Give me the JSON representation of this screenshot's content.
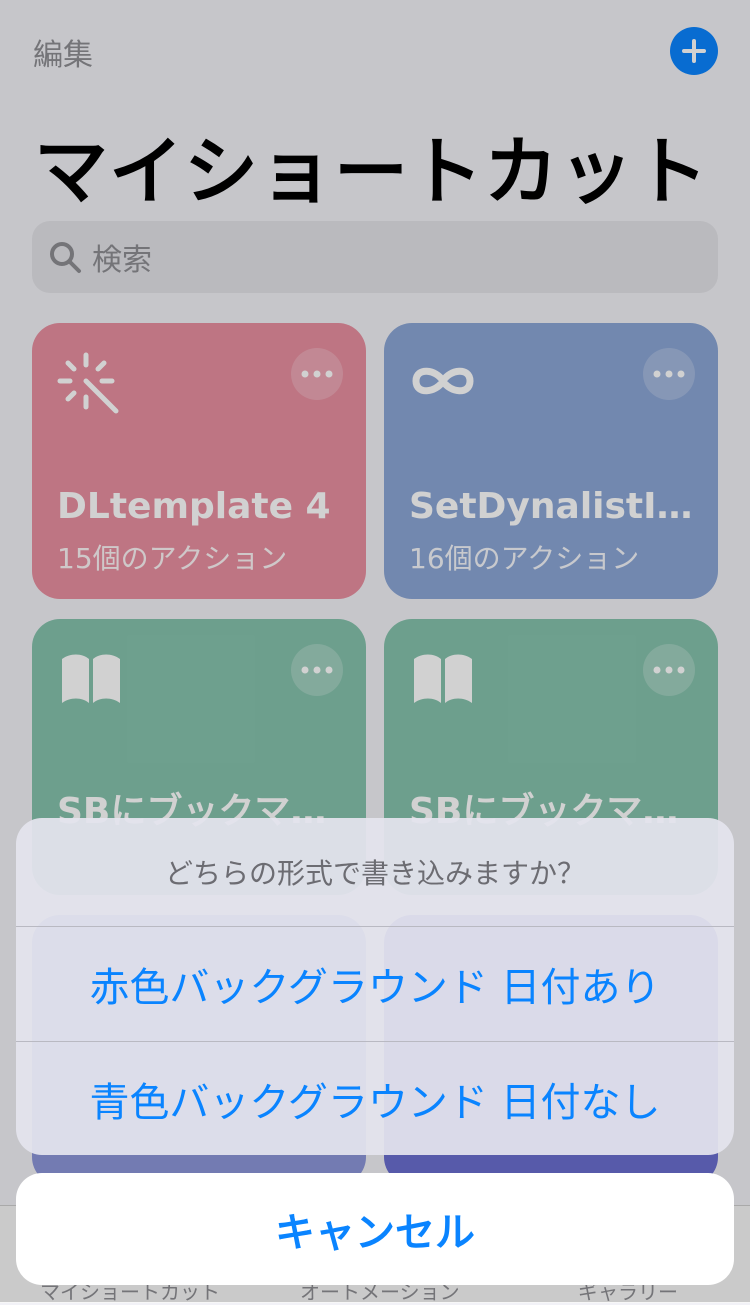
{
  "header": {
    "edit_label": "編集",
    "title": "マイショートカット"
  },
  "search": {
    "placeholder": "検索"
  },
  "shortcuts": [
    {
      "title": "DLtemplate 4",
      "subtitle": "15個のアクション",
      "color": "#e88fa0",
      "icon": "magic-wand-icon"
    },
    {
      "title": "SetDynalistI…",
      "subtitle": "16個のアクション",
      "color": "#8ba6d6",
      "icon": "infinity-icon"
    },
    {
      "title": "SBにブックマ…",
      "subtitle": "",
      "color": "#86c3ad",
      "icon": "book-icon"
    },
    {
      "title": "SBにブックマ…",
      "subtitle": "",
      "color": "#86c3ad",
      "icon": "book-icon"
    }
  ],
  "tab_bar": {
    "items": [
      "マイショートカット",
      "オートメーション",
      "ギャラリー"
    ]
  },
  "action_sheet": {
    "title": "どちらの形式で書き込みますか？",
    "options": [
      "赤色バックグラウンド 日付あり",
      "青色バックグラウンド 日付なし"
    ],
    "cancel": "キャンセル"
  },
  "colors": {
    "accent": "#0a84ff"
  }
}
